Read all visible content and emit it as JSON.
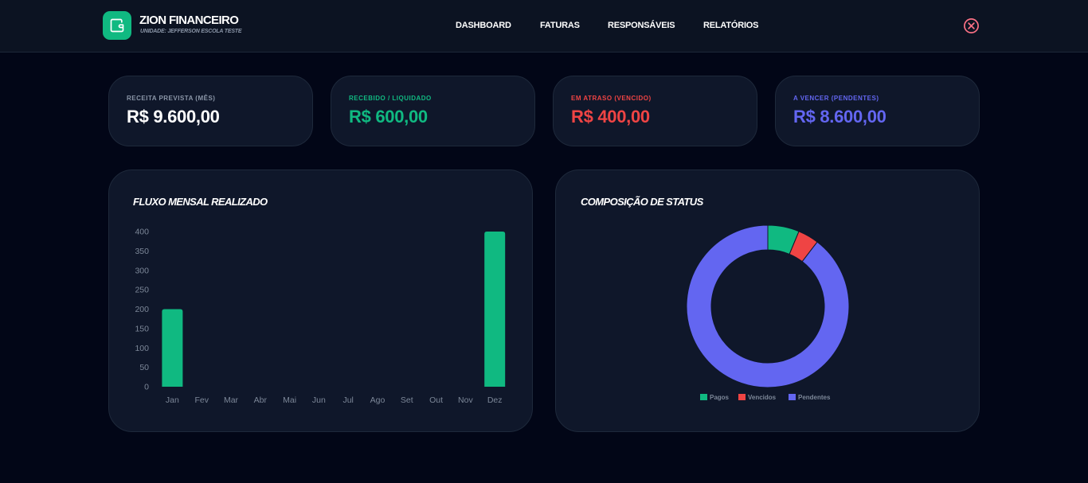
{
  "brand": {
    "title": "ZION FINANCEIRO",
    "subtitle": "UNIDADE: JEFFERSON ESCOLA TESTE"
  },
  "nav": [
    {
      "label": "DASHBOARD"
    },
    {
      "label": "FATURAS"
    },
    {
      "label": "RESPONSÁVEIS"
    },
    {
      "label": "RELATÓRIOS"
    }
  ],
  "kpis": [
    {
      "label": "RECEITA PREVISTA (MÊS)",
      "value": "R$ 9.600,00",
      "label_color": "#8b96a8",
      "value_color": "#ffffff"
    },
    {
      "label": "RECEBIDO / LIQUIDADO",
      "value": "R$ 600,00",
      "label_color": "#10b981",
      "value_color": "#10b981"
    },
    {
      "label": "EM ATRASO (VENCIDO)",
      "value": "R$ 400,00",
      "label_color": "#ef4444",
      "value_color": "#ef4444"
    },
    {
      "label": "A VENCER (PENDENTES)",
      "value": "R$ 8.600,00",
      "label_color": "#6366f1",
      "value_color": "#6366f1"
    }
  ],
  "colors": {
    "green": "#10b981",
    "red": "#ef4444",
    "indigo": "#6366f1",
    "bg": "#020617",
    "card": "#0f172a"
  },
  "icons": {
    "logo": "wallet-icon",
    "close": "close-circle-icon"
  },
  "chart_data": [
    {
      "type": "bar",
      "title": "FLUXO MENSAL REALIZADO",
      "categories": [
        "Jan",
        "Fev",
        "Mar",
        "Abr",
        "Mai",
        "Jun",
        "Jul",
        "Ago",
        "Set",
        "Out",
        "Nov",
        "Dez"
      ],
      "values": [
        200,
        0,
        0,
        0,
        0,
        0,
        0,
        0,
        0,
        0,
        0,
        400
      ],
      "ylim": [
        0,
        400
      ],
      "yticks": [
        0,
        50,
        100,
        150,
        200,
        250,
        300,
        350,
        400
      ],
      "grid": false,
      "color": "#10b981"
    },
    {
      "type": "pie",
      "title": "COMPOSIÇÃO DE STATUS",
      "categories": [
        "Pagos",
        "Vencidos",
        "Pendentes"
      ],
      "values": [
        600,
        400,
        8600
      ],
      "colors": [
        "#10b981",
        "#ef4444",
        "#6366f1"
      ],
      "legend": "bottom"
    }
  ]
}
